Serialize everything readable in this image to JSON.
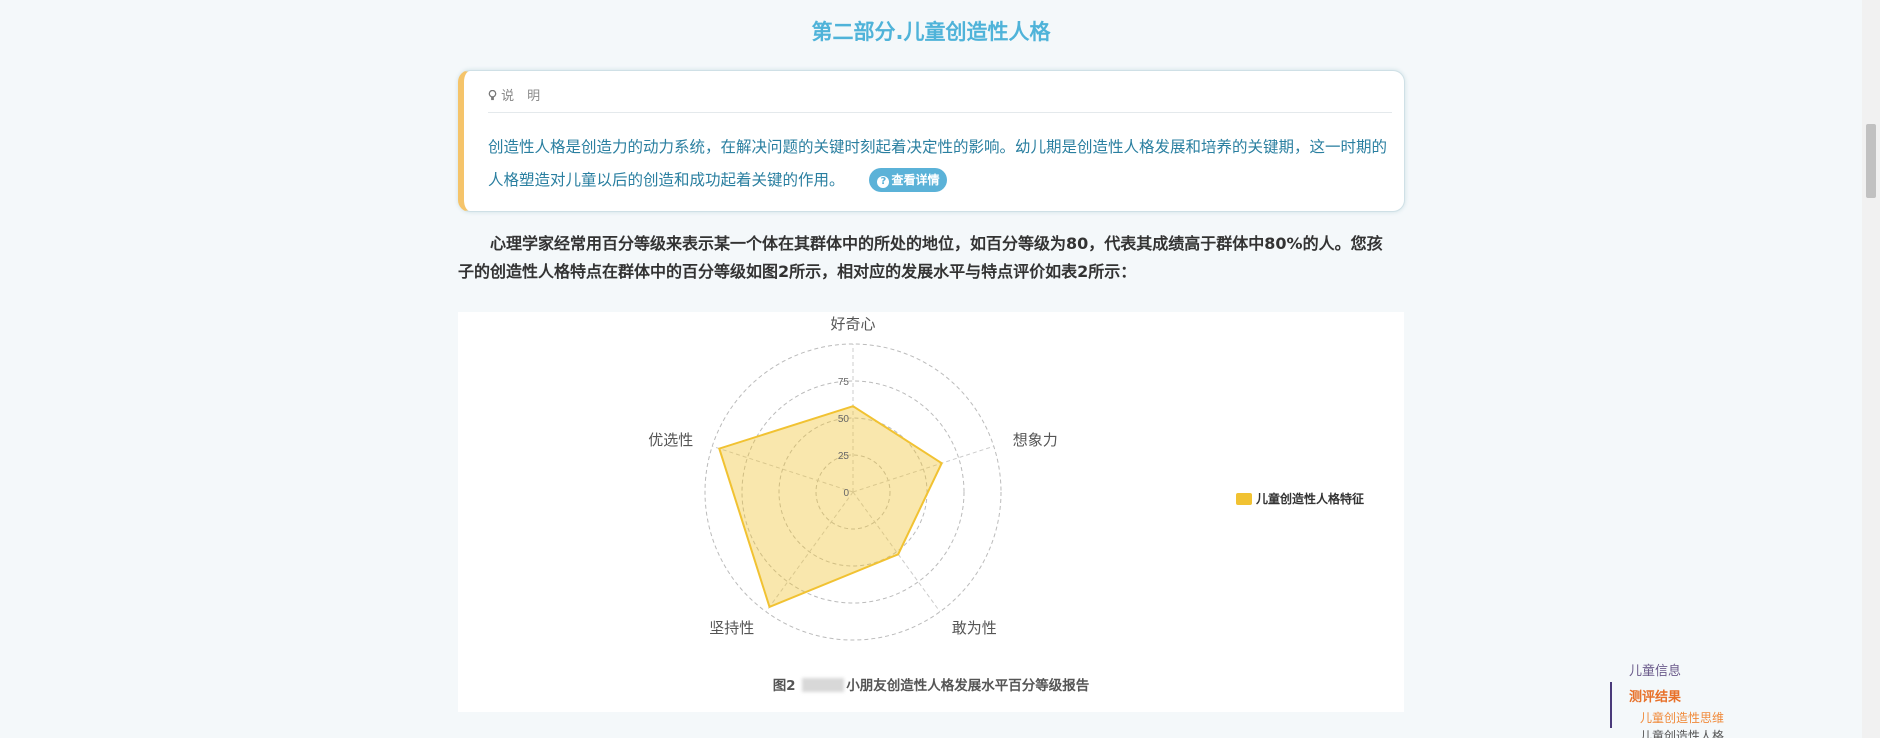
{
  "section_title": "第二部分.儿童创造性人格",
  "note": {
    "head_label": "说　明",
    "icon": "lightbulb-icon",
    "text": "创造性人格是创造力的动力系统，在解决问题的关键时刻起着决定性的影响。幼儿期是创造性人格发展和培养的关键期，这一时期的人格塑造对儿童以后的创造和成功起着关键的作用。",
    "detail_button": "查看详情",
    "accent_color": "#f5c46a"
  },
  "paragraph": "心理学家经常用百分等级来表示某一个体在其群体中的所处的地位，如百分等级为80，代表其成绩高于群体中80%的人。您孩子的创造性人格特点在群体中的百分等级如图2所示，相对应的发展水平与特点评价如表2所示：",
  "chart_data": {
    "type": "radar",
    "indicators": [
      "好奇心",
      "想象力",
      "敢为性",
      "坚持性",
      "优选性"
    ],
    "series": [
      {
        "name": "儿童创造性人格特征",
        "values": [
          58,
          63,
          52,
          96,
          95
        ],
        "color": "#f1c232"
      }
    ],
    "rlim": [
      0,
      100
    ],
    "ticks": [
      "0",
      "25",
      "50",
      "75"
    ],
    "tick_values": [
      0,
      25,
      50,
      75
    ],
    "legend_position": "right",
    "grid": true
  },
  "caption": {
    "prefix": "图2",
    "suffix": "小朋友创造性人格发展水平百分等级报告"
  },
  "toc": {
    "item1": "儿童信息",
    "item2": "测评结果",
    "sub1": "儿童创造性思维",
    "sub2": "儿童创造性人格"
  }
}
